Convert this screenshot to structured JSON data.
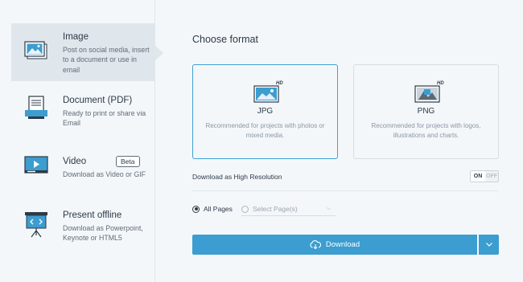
{
  "formats_sidebar": [
    {
      "title": "Image",
      "description": "Post on social media, insert to a document or use in email",
      "icon": "image-icon",
      "active": true
    },
    {
      "title": "Document (PDF)",
      "description": "Ready to print or share via Email",
      "icon": "document-pdf-icon",
      "active": false
    },
    {
      "title": "Video",
      "description": "Download as Video or GIF",
      "icon": "video-icon",
      "badge": "Beta",
      "active": false
    },
    {
      "title": "Present offline",
      "description": "Download as Powerpoint, Keynote or HTML5",
      "icon": "presentation-icon",
      "active": false
    }
  ],
  "main": {
    "heading": "Choose format",
    "cards": [
      {
        "name": "JPG",
        "badge": "HD",
        "description": "Recommended for projects with photos or mixed media.",
        "icon": "jpg-image-icon",
        "selected": true
      },
      {
        "name": "PNG",
        "badge": "HD",
        "description": "Recommended for projects with logos, illustrations and charts.",
        "icon": "png-image-icon",
        "selected": false
      }
    ],
    "high_res_label": "Download as High Resolution",
    "toggle": {
      "on": "ON",
      "off": "OFF"
    },
    "pages": {
      "all": "All Pages",
      "select": "Select Page(s)"
    },
    "download_label": "Download"
  },
  "colors": {
    "accent": "#3c9dd0",
    "selected_border": "#3f9fd5",
    "active_bg": "#dfe6ec"
  }
}
